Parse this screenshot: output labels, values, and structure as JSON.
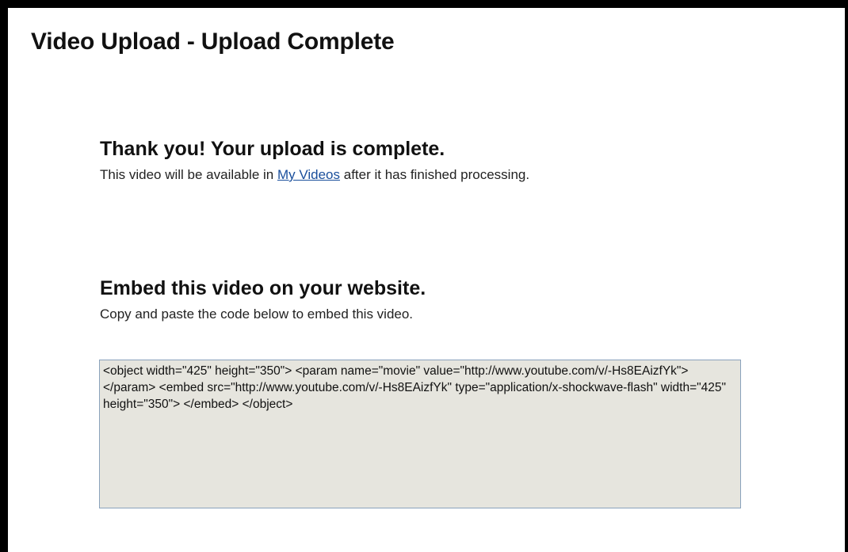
{
  "page": {
    "title": "Video Upload - Upload Complete"
  },
  "thanks": {
    "heading": "Thank you! Your upload is complete.",
    "text_before": "This video will be available in ",
    "link_label": "My Videos",
    "text_after": " after it has finished processing."
  },
  "embed": {
    "heading": "Embed this video on your website.",
    "instructions": "Copy and paste the code below to embed this video.",
    "code": "<object width=\"425\" height=\"350\"> <param name=\"movie\" value=\"http://www.youtube.com/v/-Hs8EAizfYk\"> </param> <embed src=\"http://www.youtube.com/v/-Hs8EAizfYk\" type=\"application/x-shockwave-flash\" width=\"425\" height=\"350\"> </embed> </object>"
  },
  "colors": {
    "link": "#1a4f9c",
    "code_box_background": "#e6e5de",
    "code_box_border": "#8aa2bc"
  }
}
